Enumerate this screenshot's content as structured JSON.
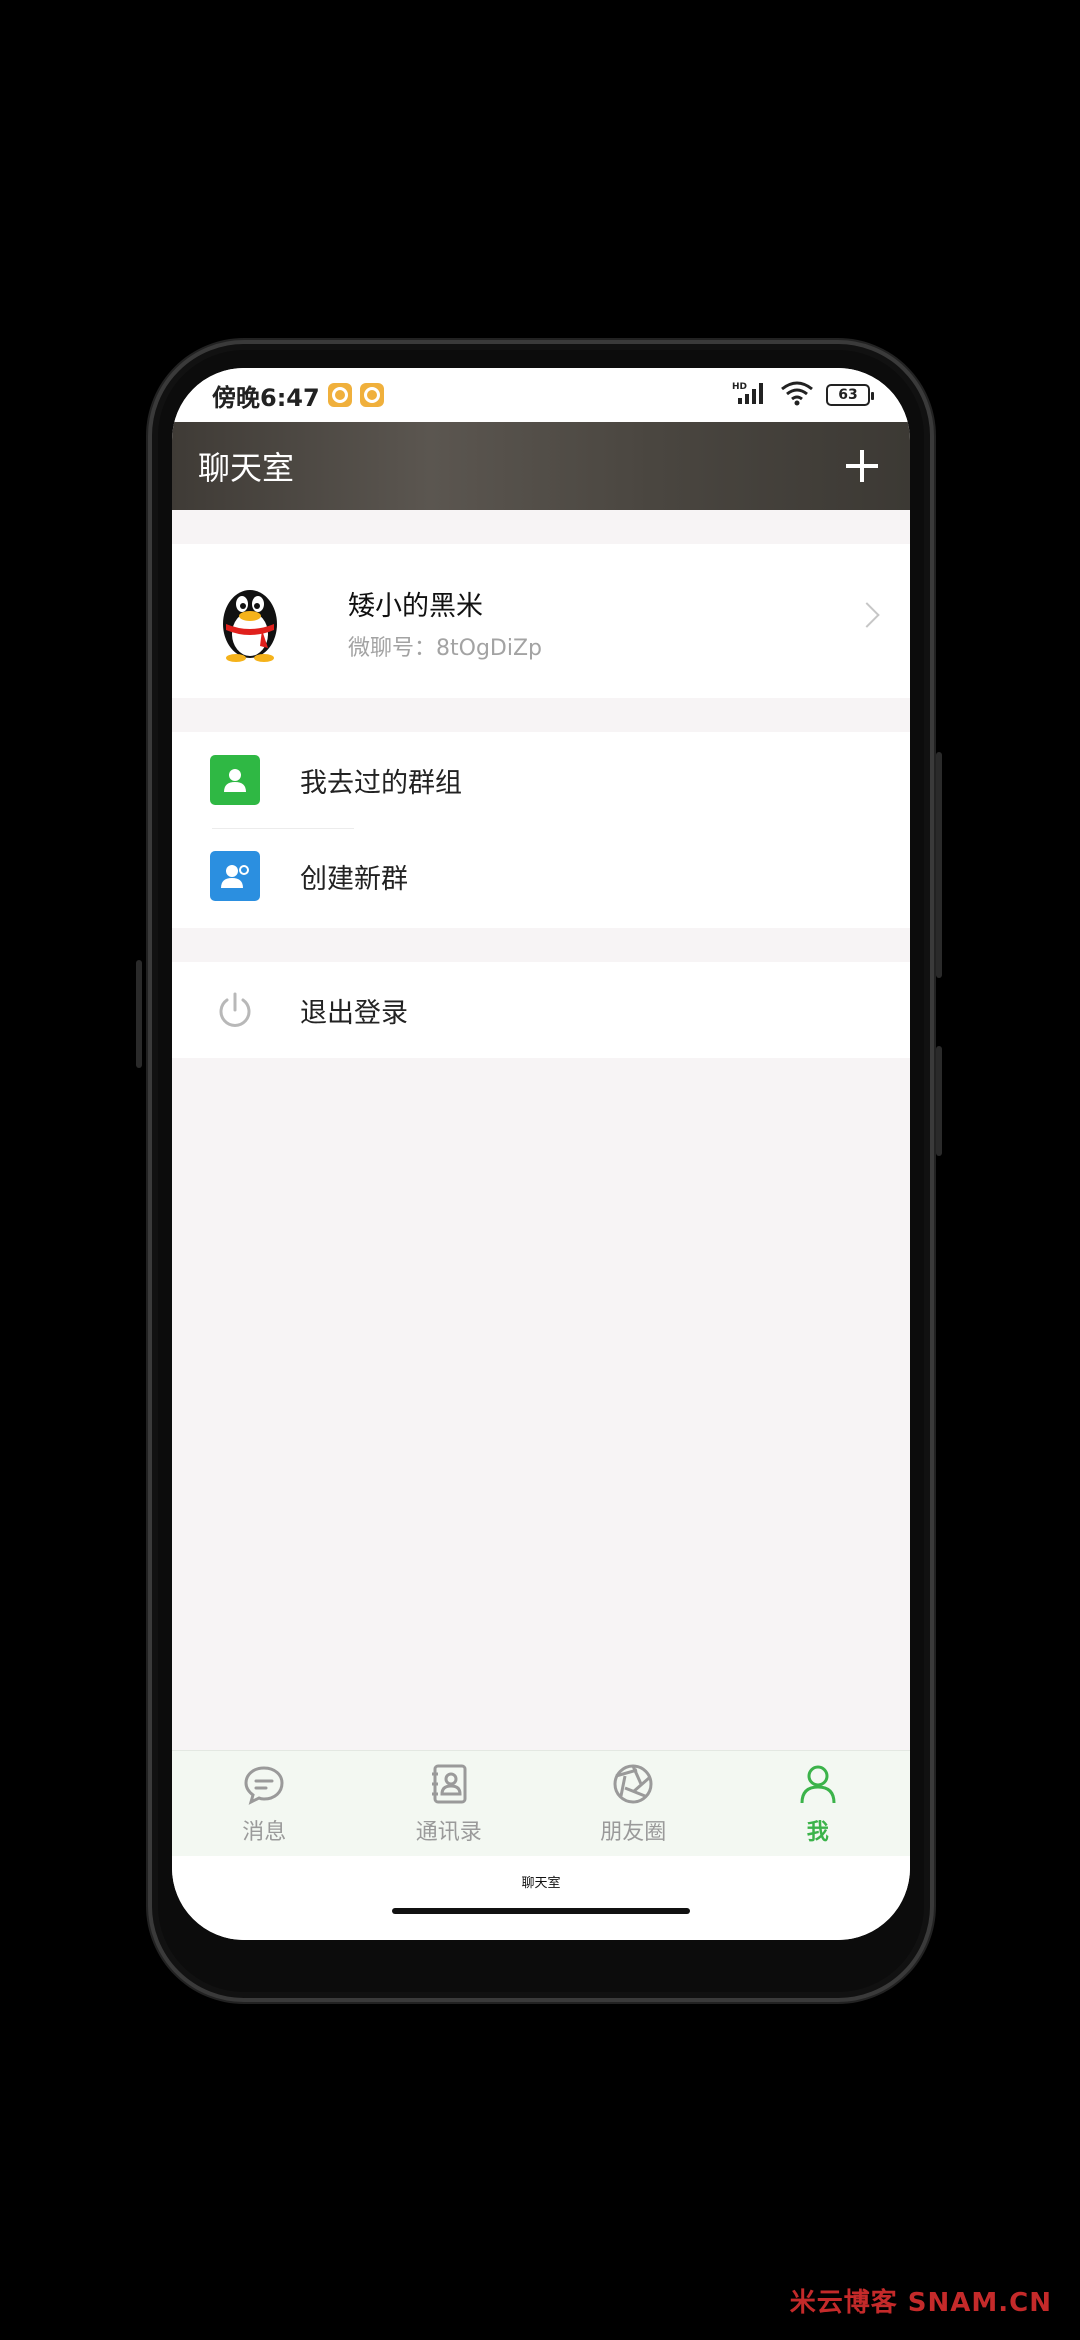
{
  "status_bar": {
    "time": "傍晚6:47",
    "network": "HD",
    "battery": "63"
  },
  "header": {
    "title": "聊天室"
  },
  "profile": {
    "name": "矮小的黑米",
    "wechat_id": "微聊号：8tOgDiZp"
  },
  "menu": {
    "groups_visited": "我去过的群组",
    "create_group": "创建新群",
    "logout": "退出登录"
  },
  "tabs": [
    {
      "label": "消息",
      "icon": "chat-bubble-icon",
      "active": false
    },
    {
      "label": "通讯录",
      "icon": "contacts-icon",
      "active": false
    },
    {
      "label": "朋友圈",
      "icon": "moments-aperture-icon",
      "active": false
    },
    {
      "label": "我",
      "icon": "person-icon",
      "active": true
    }
  ],
  "app_caption": "聊天室",
  "watermark": "米云博客  SNAM.CN",
  "colors": {
    "accent_green": "#3bb34a",
    "group_icon_green": "#2fb844",
    "create_icon_blue": "#2b8fe0"
  }
}
